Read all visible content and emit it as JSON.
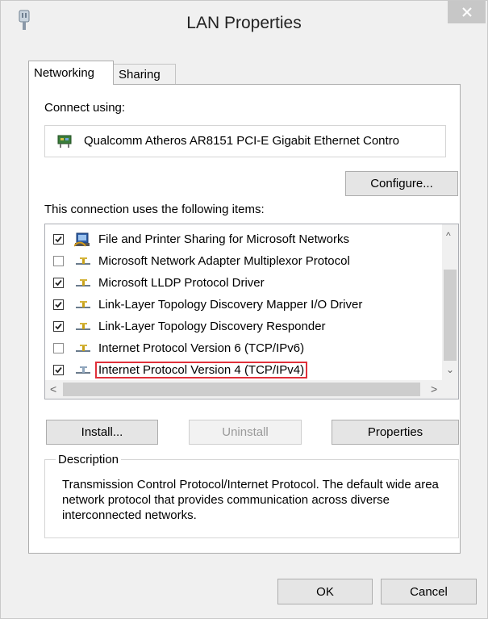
{
  "window": {
    "title": "LAN Properties",
    "close_icon": "close-icon",
    "app_icon": "network-adapter-icon"
  },
  "tabs": [
    {
      "label": "Networking",
      "active": true
    },
    {
      "label": "Sharing",
      "active": false
    }
  ],
  "connect_using": {
    "label": "Connect using:",
    "adapter_name": "Qualcomm Atheros AR8151 PCI-E Gigabit Ethernet Contro",
    "adapter_icon": "network-adapter-icon"
  },
  "buttons": {
    "configure": "Configure...",
    "install": "Install...",
    "uninstall": "Uninstall",
    "properties": "Properties",
    "ok": "OK",
    "cancel": "Cancel"
  },
  "items_label": "This connection uses the following items:",
  "items": [
    {
      "label": "File and Printer Sharing for Microsoft Networks",
      "checked": true,
      "icon": "printer-share-icon"
    },
    {
      "label": "Microsoft Network Adapter Multiplexor Protocol",
      "checked": false,
      "icon": "protocol-icon"
    },
    {
      "label": "Microsoft LLDP Protocol Driver",
      "checked": true,
      "icon": "protocol-icon"
    },
    {
      "label": "Link-Layer Topology Discovery Mapper I/O Driver",
      "checked": true,
      "icon": "protocol-icon"
    },
    {
      "label": "Link-Layer Topology Discovery Responder",
      "checked": true,
      "icon": "protocol-icon"
    },
    {
      "label": "Internet Protocol Version 6 (TCP/IPv6)",
      "checked": false,
      "icon": "protocol-icon"
    },
    {
      "label": "Internet Protocol Version 4 (TCP/IPv4)",
      "checked": true,
      "icon": "protocol-icon",
      "highlighted": true
    }
  ],
  "description": {
    "legend": "Description",
    "text": "Transmission Control Protocol/Internet Protocol. The default wide area network protocol that provides communication across diverse interconnected networks."
  },
  "colors": {
    "highlight_border": "#e0303a",
    "close_button_bg": "#c7c7c7"
  }
}
